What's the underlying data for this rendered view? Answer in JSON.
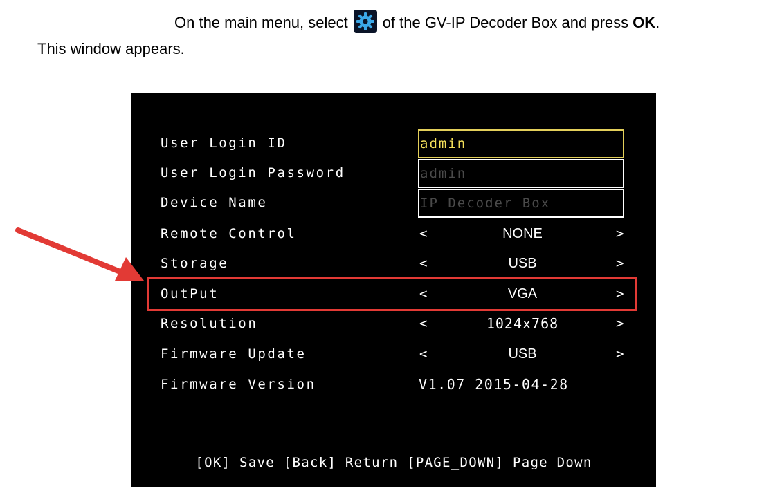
{
  "instruction": {
    "line1_prefix": "On the main menu, select",
    "line1_suffix": "of the GV-IP Decoder Box and press",
    "ok_word": "OK",
    "period": ".",
    "line2": "This window appears.",
    "icon": "gear-icon",
    "icon_color": "#3ba8e8"
  },
  "menu": {
    "login_id": {
      "label": "User Login ID",
      "value": "admin"
    },
    "login_password": {
      "label": "User Login Password",
      "value": "admin"
    },
    "device_name": {
      "label": "Device Name",
      "value": "IP Decoder Box"
    },
    "remote_control": {
      "label": "Remote Control",
      "value": "NONE",
      "left": "<",
      "right": ">"
    },
    "storage": {
      "label": "Storage",
      "value": "USB",
      "left": "<",
      "right": ">"
    },
    "output": {
      "label": "OutPut",
      "value": "VGA",
      "left": "<",
      "right": ">"
    },
    "resolution": {
      "label": "Resolution",
      "value": "1024x768",
      "left": "<",
      "right": ">"
    },
    "firmware_update": {
      "label": "Firmware Update",
      "value": "USB",
      "left": "<",
      "right": ">"
    },
    "firmware_version": {
      "label": "Firmware Version",
      "value": "V1.07 2015-04-28"
    }
  },
  "footer": "[OK] Save [Back] Return [PAGE_DOWN] Page Down",
  "colors": {
    "osd_background": "#000000",
    "active_field": "#f3df5a",
    "dim_text": "#4a4a4a",
    "annotation": "#e23a35"
  }
}
